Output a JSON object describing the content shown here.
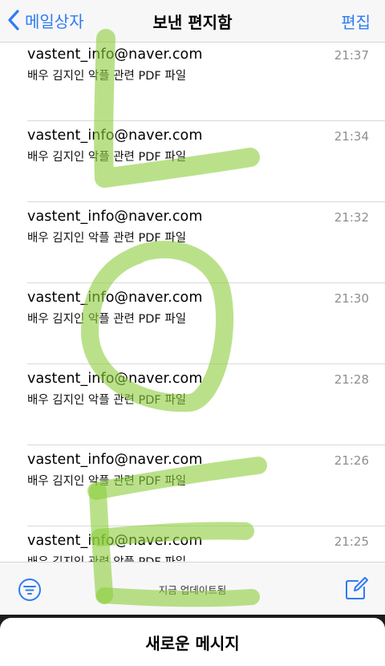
{
  "navbar": {
    "back_label": "메일상자",
    "title": "보낸 편지함",
    "edit_label": "편집",
    "accent_color": "#2f7bf3"
  },
  "mails": [
    {
      "sender": "vastent_info@naver.com",
      "subject": "배우 김지인 악플 관련 PDF 파일",
      "time": "21:37"
    },
    {
      "sender": "vastent_info@naver.com",
      "subject": "배우 김지인 악플 관련 PDF 파일",
      "time": "21:34"
    },
    {
      "sender": "vastent_info@naver.com",
      "subject": "배우 김지인 악플 관련 PDF 파일",
      "time": "21:32"
    },
    {
      "sender": "vastent_info@naver.com",
      "subject": "배우 김지인 악플 관련 PDF 파일",
      "time": "21:30"
    },
    {
      "sender": "vastent_info@naver.com",
      "subject": "배우 김지인 악플 관련 PDF 파일",
      "time": "21:28"
    },
    {
      "sender": "vastent_info@naver.com",
      "subject": "배우 김지인 악플 관련 PDF 파일",
      "time": "21:26"
    },
    {
      "sender": "vastent_info@naver.com",
      "subject": "배우 김지인 관련 악플 PDF 파일",
      "time": "21:25"
    }
  ],
  "toolbar": {
    "filter_icon": "filter-icon",
    "status": "지금 업데이트됨",
    "compose_icon": "compose-icon"
  },
  "sheet": {
    "title": "새로운 메시지"
  },
  "overlay": {
    "description_color": "#8ccd3c"
  }
}
